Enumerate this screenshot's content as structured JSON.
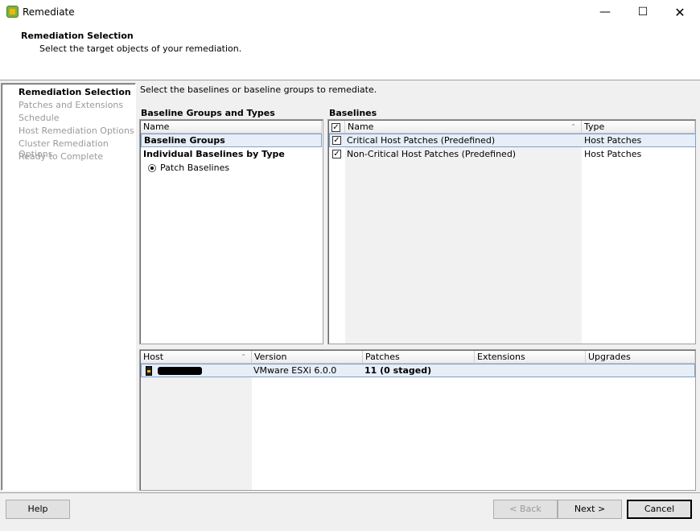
{
  "window": {
    "title": "Remediate"
  },
  "header": {
    "title": "Remediation Selection",
    "subtitle": "Select the target objects of your remediation."
  },
  "nav": {
    "items": [
      {
        "label": "Remediation Selection"
      },
      {
        "label": "Patches and Extensions"
      },
      {
        "label": "Schedule"
      },
      {
        "label": "Host Remediation Options"
      },
      {
        "label": "Cluster Remediation Options"
      },
      {
        "label": "Ready to Complete"
      }
    ]
  },
  "main": {
    "instruction": "Select the baselines or baseline groups to remediate.",
    "groups": {
      "title": "Baseline Groups and Types",
      "col": "Name",
      "row1": "Baseline Groups",
      "row2": "Individual Baselines by Type",
      "radio": "Patch Baselines"
    },
    "baselines": {
      "title": "Baselines",
      "cols": [
        "Name",
        "Type"
      ],
      "rows": [
        {
          "name": "Critical Host Patches (Predefined)",
          "type": "Host Patches",
          "checked": true
        },
        {
          "name": "Non-Critical Host Patches (Predefined)",
          "type": "Host Patches",
          "checked": true
        }
      ]
    },
    "hosts": {
      "cols": [
        "Host",
        "Version",
        "Patches",
        "Extensions",
        "Upgrades"
      ],
      "rows": [
        {
          "version": "VMware ESXi 6.0.0",
          "patches": "11 (0 staged)"
        }
      ]
    }
  },
  "footer": {
    "help": "Help",
    "back": "< Back",
    "next": "Next >",
    "cancel": "Cancel"
  }
}
